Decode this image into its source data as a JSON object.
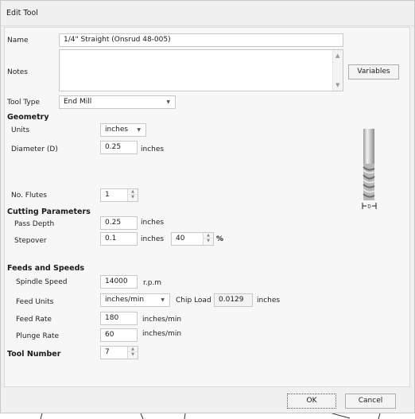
{
  "window": {
    "title": "Edit Tool"
  },
  "name": {
    "label": "Name",
    "value": "1/4\" Straight  (Onsrud 48-005)"
  },
  "notes": {
    "label": "Notes",
    "value": ""
  },
  "variables_button": "Variables",
  "tool_type": {
    "label": "Tool Type",
    "value": "End Mill"
  },
  "geometry": {
    "title": "Geometry",
    "units": {
      "label": "Units",
      "value": "inches"
    },
    "diameter": {
      "label": "Diameter (D)",
      "value": "0.25",
      "unit": "inches"
    },
    "flutes": {
      "label": "No. Flutes",
      "value": "1"
    }
  },
  "cutting": {
    "title": "Cutting Parameters",
    "pass_depth": {
      "label": "Pass Depth",
      "value": "0.25",
      "unit": "inches"
    },
    "stepover": {
      "label": "Stepover",
      "value": "0.1",
      "unit": "inches",
      "percent_value": "40",
      "percent_symbol": "%"
    }
  },
  "feeds": {
    "title": "Feeds and Speeds",
    "spindle_speed": {
      "label": "Spindle Speed",
      "value": "14000",
      "unit": "r.p.m"
    },
    "feed_units": {
      "label": "Feed Units",
      "value": "inches/min"
    },
    "chip_load": {
      "label": "Chip Load",
      "value": "0.0129",
      "unit": "inches"
    },
    "feed_rate": {
      "label": "Feed Rate",
      "value": "180",
      "unit": "inches/min"
    },
    "plunge_rate": {
      "label": "Plunge Rate",
      "value": "60",
      "unit": "inches/min"
    }
  },
  "tool_number": {
    "label": "Tool Number",
    "value": "7"
  },
  "tool_diagram": {
    "dimension_label": "D"
  },
  "buttons": {
    "ok": "OK",
    "cancel": "Cancel"
  },
  "icons": {
    "dropdown": "chevron-down-icon",
    "spin_up": "spin-up-icon",
    "spin_down": "spin-down-icon",
    "scroll_up": "scroll-up-icon",
    "scroll_down": "scroll-down-icon"
  }
}
